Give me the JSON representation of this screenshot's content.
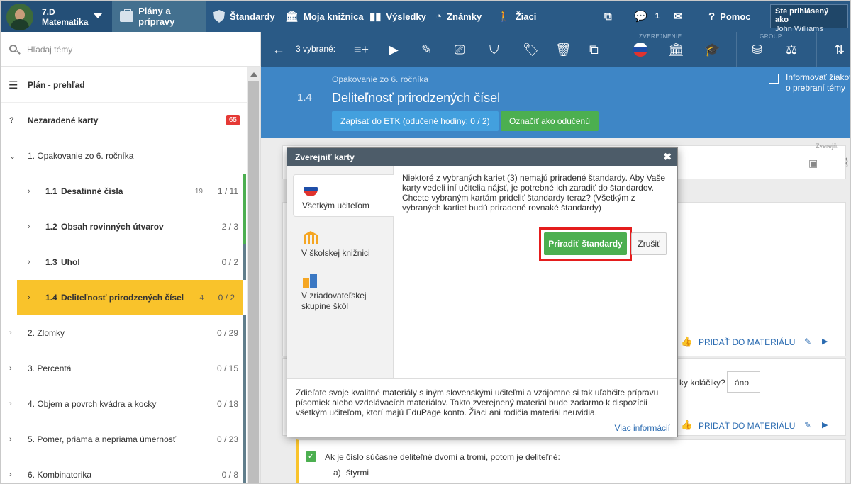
{
  "topbar": {
    "class_line1": "7.D",
    "class_line2": "Matematika",
    "nav": [
      "Plány a prípravy",
      "Štandardy",
      "Moja knižnica",
      "Výsledky",
      "Známky",
      "Žiaci"
    ],
    "messages_count": "1",
    "help": "Pomoc",
    "user_label": "Ste prihlásený ako",
    "user_name": "John Williams"
  },
  "sidebar": {
    "search_placeholder": "Hľadaj témy",
    "overview": "Plán - prehľad",
    "unassigned": "Nezaradené karty",
    "unassigned_count": "65",
    "items": [
      {
        "label": "1. Opakovanie zo 6. ročníka",
        "count": ""
      },
      {
        "num": "1.1",
        "label": "Desatinné čísla",
        "small": "19",
        "count": "1 / 11"
      },
      {
        "num": "1.2",
        "label": "Obsah rovinných útvarov",
        "small": "",
        "count": "2 / 3"
      },
      {
        "num": "1.3",
        "label": "Uhol",
        "small": "",
        "count": "0 / 2"
      },
      {
        "num": "1.4",
        "label": "Deliteľnosť prirodzených čísel",
        "small": "4",
        "count": "0 / 2"
      },
      {
        "label": "2. Zlomky",
        "count": "0 / 29"
      },
      {
        "label": "3. Percentá",
        "count": "0 / 15"
      },
      {
        "label": "4. Objem a povrch kvádra a kocky",
        "count": "0 / 18"
      },
      {
        "label": "5. Pomer, priama a nepriama úmernosť",
        "count": "0 / 23"
      },
      {
        "label": "6. Kombinatorika",
        "count": "0 / 8"
      }
    ]
  },
  "toolbar": {
    "selected": "3 vybrané:",
    "group_public": "ZVEREJNENIE",
    "group_group": "GROUP"
  },
  "header": {
    "number": "1.4",
    "crumb": "Opakovanie zo 6. ročníka",
    "title": "Deliteľnosť prirodzených čísel",
    "btn_etk": "Zapísať do ETK (odučené hodiny: 0 / 2)",
    "btn_mark": "Označiť ako odučenú",
    "inform": "Informovať žiakov o prebraní témy"
  },
  "content": {
    "add_material": "PRIDAŤ DO MATERIÁLU",
    "question_tail": "ky koláčiky?",
    "answer": "áno",
    "question": "Ak je číslo súčasne deliteľné dvomi a tromi, potom je deliteľné:",
    "option_a_letter": "a)",
    "option_a": "štyrmi",
    "small_note": "Zverejň."
  },
  "modal": {
    "title": "Zverejniť karty",
    "tabs": [
      "Všetkým učiteľom",
      "V školskej knižnici",
      "V zriadovateľskej skupine škôl"
    ],
    "message": "Niektoré z vybraných kariet (3) nemajú priradené štandardy. Aby Vaše karty vedeli iní učitelia nájsť, je potrebné ich zaradiť do štandardov. Chcete vybraným kartám prideliť štandardy teraz? (Všetkým z vybraných kartiet budú priradené rovnaké štandardy)",
    "btn_assign": "Priradiť štandardy",
    "btn_cancel": "Zrušiť",
    "footer": "Zdieľate svoje kvalitné materiály s iným slovenskými učiteľmi a vzájomne si tak uľahčite prípravu písomiek alebo vzdelávacích materiálov. Takto zverejnený materiál bude zadarmo k dispozícii všetkým učiteľom, ktorí majú EduPage konto. Žiaci ani rodičia materiál neuvidia.",
    "more_info": "Viac informácií"
  },
  "colors": {
    "topbar": "#2a5a86",
    "header": "#3e86c6",
    "active_row": "#f9c32b",
    "green": "#4caf50",
    "highlight": "#e41d1d"
  }
}
